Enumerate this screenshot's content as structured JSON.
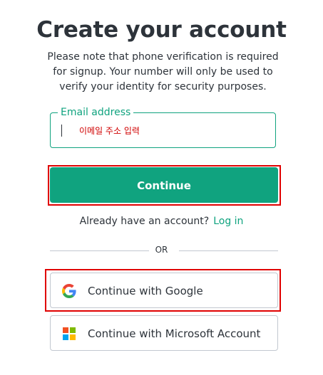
{
  "heading": "Create your account",
  "notice": "Please note that phone verification is required for signup. Your number will only be used to verify your identity for security purposes.",
  "email": {
    "label": "Email address",
    "value": "이메일 주소 입력"
  },
  "continue_label": "Continue",
  "login_prompt": {
    "question": "Already have an account?",
    "link": "Log in"
  },
  "divider": "OR",
  "social": {
    "google_label": "Continue with Google",
    "microsoft_label": "Continue with Microsoft Account"
  },
  "colors": {
    "accent": "#10a37f",
    "highlight": "#e00000",
    "text": "#2d333a",
    "border": "#c2c8d0"
  },
  "icons": [
    "google-logo-icon",
    "microsoft-logo-icon"
  ]
}
